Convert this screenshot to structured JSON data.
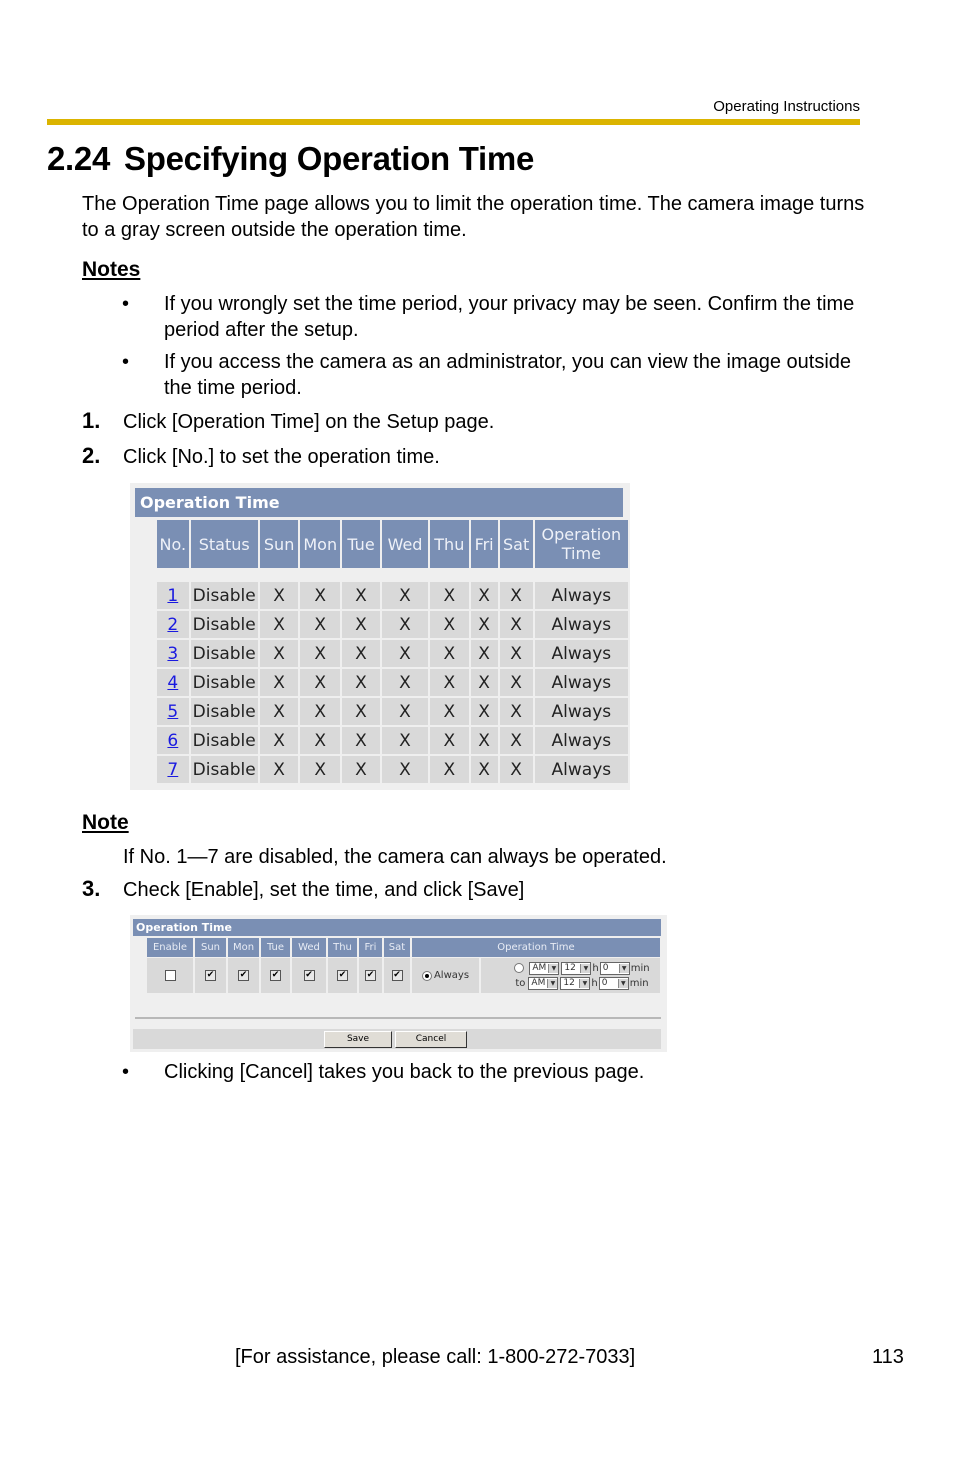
{
  "header": {
    "label": "Operating Instructions",
    "bar_color": "#dbb400"
  },
  "section": {
    "number": "2.24",
    "title": "Specifying Operation Time"
  },
  "intro": "The Operation Time page allows you to limit the operation time. The camera image turns to a gray screen outside the operation time.",
  "notes": {
    "heading": "Notes",
    "items": [
      "If you wrongly set the time period, your privacy may be seen. Confirm the time period after the setup.",
      "If you access the camera as an administrator, you can view the image outside the time period."
    ]
  },
  "steps": [
    {
      "num": "1.",
      "text": "Click [Operation Time] on the Setup page."
    },
    {
      "num": "2.",
      "text": "Click [No.] to set the operation time."
    },
    {
      "num": "3.",
      "text": "Check [Enable], set the time, and click [Save]"
    }
  ],
  "screenshot1": {
    "caption": "Operation Time",
    "columns": [
      "No.",
      "Status",
      "Sun",
      "Mon",
      "Tue",
      "Wed",
      "Thu",
      "Fri",
      "Sat",
      "Operation Time"
    ],
    "rows": [
      {
        "no": "1",
        "status": "Disable",
        "days": [
          "X",
          "X",
          "X",
          "X",
          "X",
          "X",
          "X"
        ],
        "time": "Always"
      },
      {
        "no": "2",
        "status": "Disable",
        "days": [
          "X",
          "X",
          "X",
          "X",
          "X",
          "X",
          "X"
        ],
        "time": "Always"
      },
      {
        "no": "3",
        "status": "Disable",
        "days": [
          "X",
          "X",
          "X",
          "X",
          "X",
          "X",
          "X"
        ],
        "time": "Always"
      },
      {
        "no": "4",
        "status": "Disable",
        "days": [
          "X",
          "X",
          "X",
          "X",
          "X",
          "X",
          "X"
        ],
        "time": "Always"
      },
      {
        "no": "5",
        "status": "Disable",
        "days": [
          "X",
          "X",
          "X",
          "X",
          "X",
          "X",
          "X"
        ],
        "time": "Always"
      },
      {
        "no": "6",
        "status": "Disable",
        "days": [
          "X",
          "X",
          "X",
          "X",
          "X",
          "X",
          "X"
        ],
        "time": "Always"
      },
      {
        "no": "7",
        "status": "Disable",
        "days": [
          "X",
          "X",
          "X",
          "X",
          "X",
          "X",
          "X"
        ],
        "time": "Always"
      }
    ],
    "header_color": "#7a8fb4"
  },
  "note": {
    "heading": "Note",
    "text": "If No. 1—7 are disabled, the camera can always be operated."
  },
  "screenshot2": {
    "caption": "Operation Time",
    "columns": [
      "Enable",
      "Sun",
      "Mon",
      "Tue",
      "Wed",
      "Thu",
      "Fri",
      "Sat",
      "Operation Time"
    ],
    "enable_checked": false,
    "days_checked": [
      true,
      true,
      true,
      true,
      true,
      true,
      true
    ],
    "always_label": "Always",
    "always_selected": true,
    "from": {
      "ampm": "AM",
      "hour": "12",
      "h_label": "h",
      "minute": "0",
      "min_label": "min"
    },
    "to_label": "to",
    "to": {
      "ampm": "AM",
      "hour": "12",
      "h_label": "h",
      "minute": "0",
      "min_label": "min"
    },
    "save_label": "Save",
    "cancel_label": "Cancel"
  },
  "after_note": "Clicking [Cancel] takes you back to the previous page.",
  "bullet": "•",
  "footer": {
    "assistance": "[For assistance, please call: 1-800-272-7033]",
    "page": "113"
  }
}
